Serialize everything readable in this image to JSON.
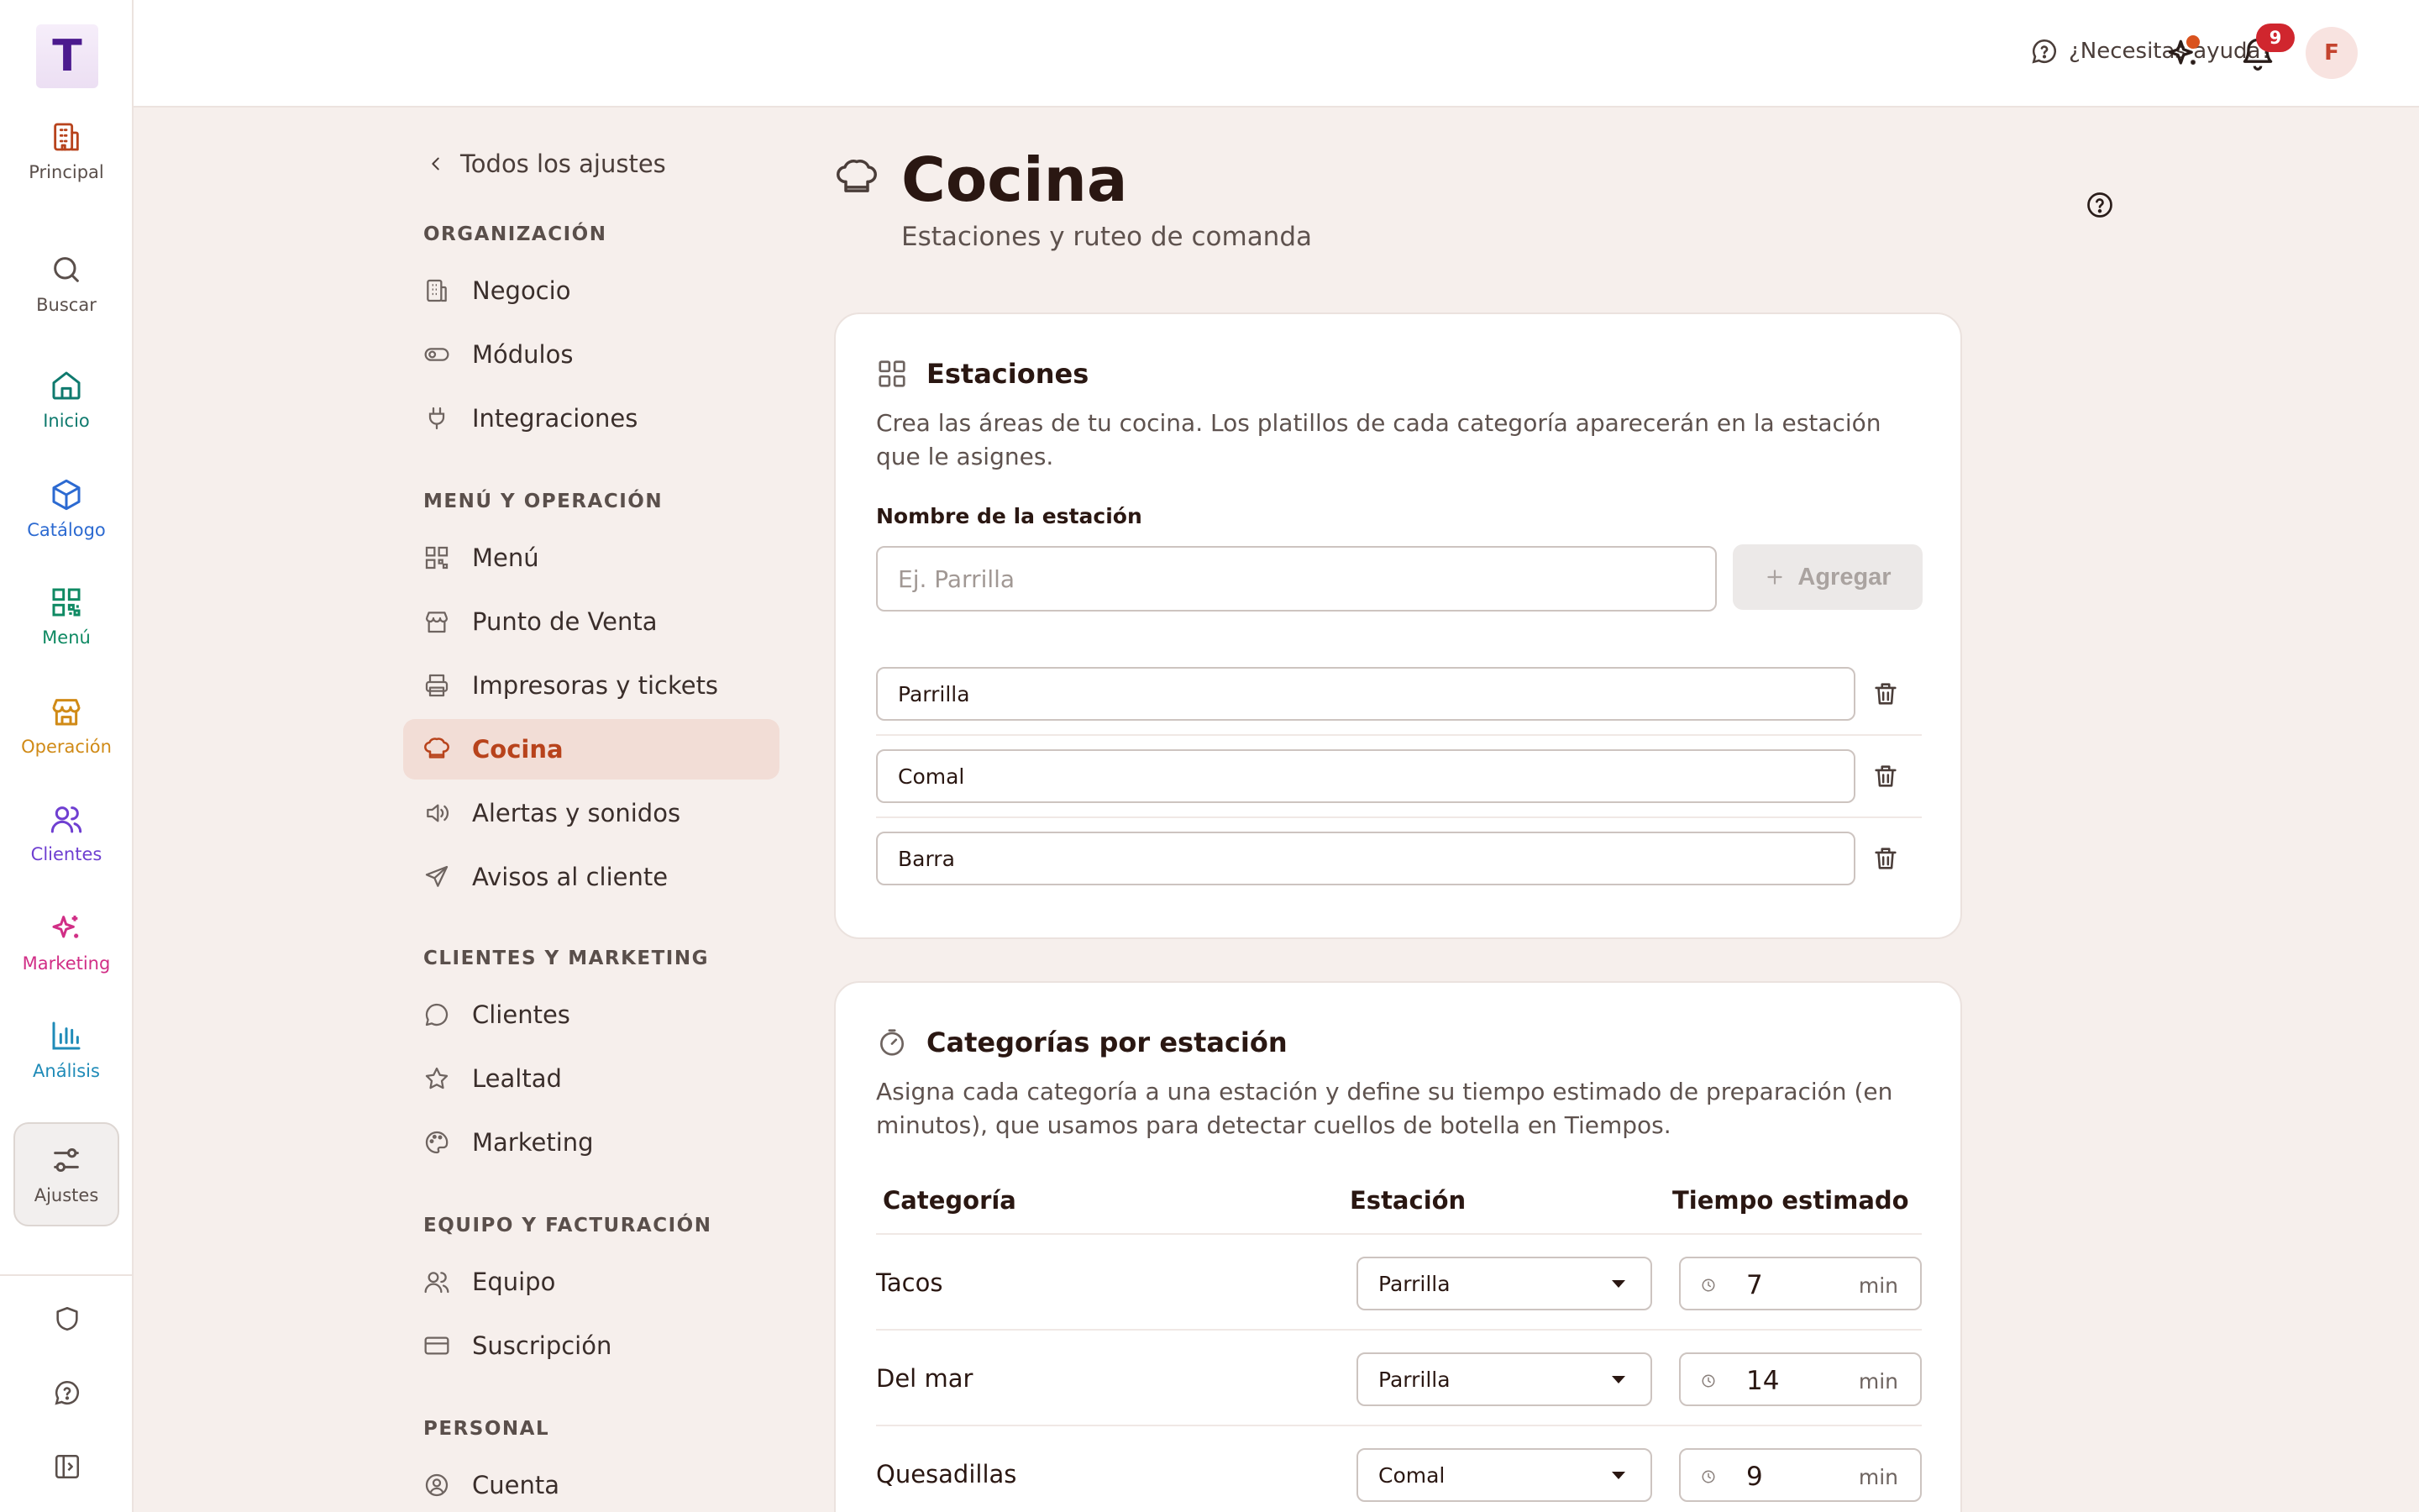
{
  "app": {
    "logo_letter": "T"
  },
  "rail": {
    "items": [
      {
        "label": "Principal",
        "color": "#b8431c",
        "icon": "building-icon"
      },
      {
        "label": "Buscar",
        "color": "#5a4f4b",
        "icon": "search-icon"
      },
      {
        "label": "Inicio",
        "color": "#0f7a6e",
        "icon": "home-icon"
      },
      {
        "label": "Catálogo",
        "color": "#2c6ad1",
        "icon": "box-icon"
      },
      {
        "label": "Menú",
        "color": "#0f8a63",
        "icon": "qr-icon"
      },
      {
        "label": "Operación",
        "color": "#d08a16",
        "icon": "store-icon"
      },
      {
        "label": "Clientes",
        "color": "#6f3fd1",
        "icon": "users-icon"
      },
      {
        "label": "Marketing",
        "color": "#d12e86",
        "icon": "sparkles-icon"
      },
      {
        "label": "Análisis",
        "color": "#1f8bb8",
        "icon": "bar-chart-icon"
      },
      {
        "label": "Ajustes",
        "color": "#5a4f4b",
        "icon": "sliders-icon"
      }
    ]
  },
  "topbar": {
    "help_label": "¿Necesitas ayuda?",
    "notification_count": "9",
    "avatar_initial": "F"
  },
  "settings_nav": {
    "back_label": "Todos los ajustes",
    "sections": [
      {
        "title": "ORGANIZACIÓN",
        "items": [
          "Negocio",
          "Módulos",
          "Integraciones"
        ]
      },
      {
        "title": "MENÚ Y OPERACIÓN",
        "items": [
          "Menú",
          "Punto de Venta",
          "Impresoras y tickets",
          "Cocina",
          "Alertas y sonidos",
          "Avisos al cliente"
        ]
      },
      {
        "title": "CLIENTES Y MARKETING",
        "items": [
          "Clientes",
          "Lealtad",
          "Marketing"
        ]
      },
      {
        "title": "EQUIPO Y FACTURACIÓN",
        "items": [
          "Equipo",
          "Suscripción"
        ]
      },
      {
        "title": "PERSONAL",
        "items": [
          "Cuenta"
        ]
      }
    ],
    "active_item": "Cocina"
  },
  "page": {
    "title": "Cocina",
    "subtitle": "Estaciones y ruteo de comanda"
  },
  "stations": {
    "title": "Estaciones",
    "description": "Crea las áreas de tu cocina. Los platillos de cada categoría aparecerán en la estación que le asignes.",
    "name_label": "Nombre de la estación",
    "name_placeholder": "Ej. Parrilla",
    "add_label": "Agregar",
    "list": [
      "Parrilla",
      "Comal",
      "Barra"
    ]
  },
  "categories": {
    "title": "Categorías por estación",
    "description": "Asigna cada categoría a una estación y define su tiempo estimado de preparación (en minutos), que usamos para detectar cuellos de botella en Tiempos.",
    "columns": [
      "Categoría",
      "Estación",
      "Tiempo estimado"
    ],
    "unit": "min",
    "rows": [
      {
        "name": "Tacos",
        "station": "Parrilla",
        "time": "7"
      },
      {
        "name": "Del mar",
        "station": "Parrilla",
        "time": "14"
      },
      {
        "name": "Quesadillas",
        "station": "Comal",
        "time": "9"
      }
    ]
  },
  "colors": {
    "accent": "#b8431c",
    "active_bg": "#f2ddd6",
    "page_bg": "#f6efec"
  }
}
